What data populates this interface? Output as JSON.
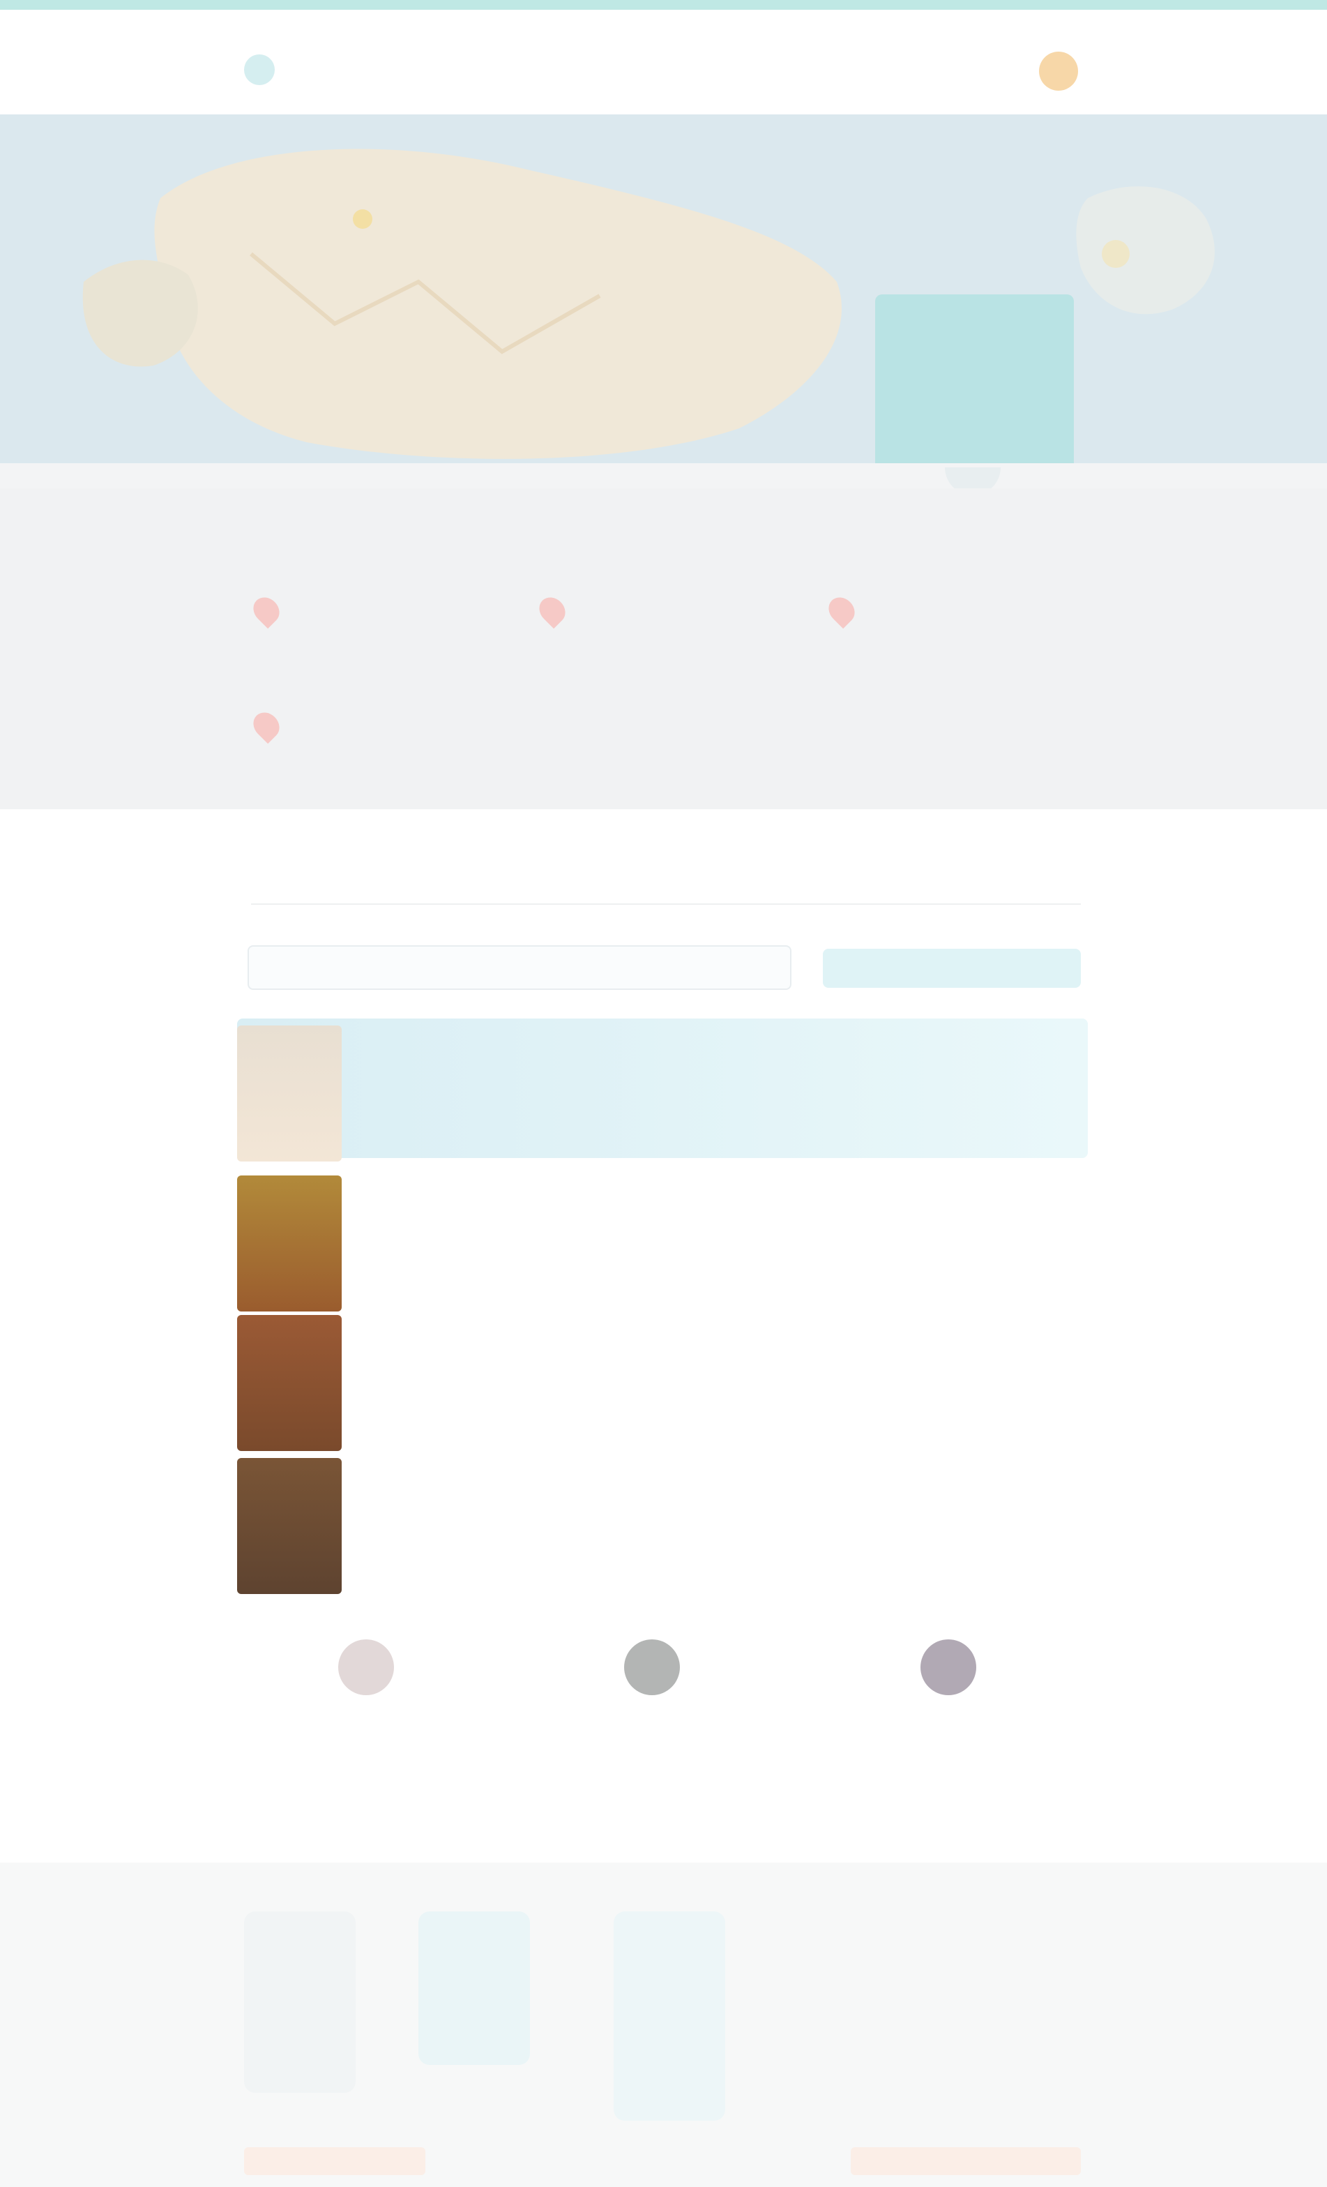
{
  "header": {
    "site_name": "",
    "user_icon": "user-avatar-icon"
  },
  "hero": {
    "map_icon": "map-background",
    "promo_text": "",
    "promo_button": ""
  },
  "features": {
    "icon": "map-pin-icon",
    "items": [
      {
        "label": ""
      },
      {
        "label": ""
      },
      {
        "label": ""
      },
      {
        "label": ""
      }
    ]
  },
  "listings": {
    "section_title": "",
    "search_placeholder": "",
    "view_all_label": "",
    "items": [
      {
        "title": "",
        "price": "",
        "active": true
      },
      {
        "title": "",
        "price": "",
        "active": false
      },
      {
        "title": "",
        "price": "",
        "active": false
      },
      {
        "title": "",
        "price": "",
        "active": false
      }
    ]
  },
  "agents": [
    {
      "name": "",
      "role": ""
    },
    {
      "name": "",
      "role": ""
    },
    {
      "name": "",
      "role": ""
    }
  ],
  "footer": {
    "title": ""
  },
  "colors": {
    "accent": "#b9e3e4",
    "promo_button": "#e5d596",
    "pin": "#f6c9c6"
  }
}
